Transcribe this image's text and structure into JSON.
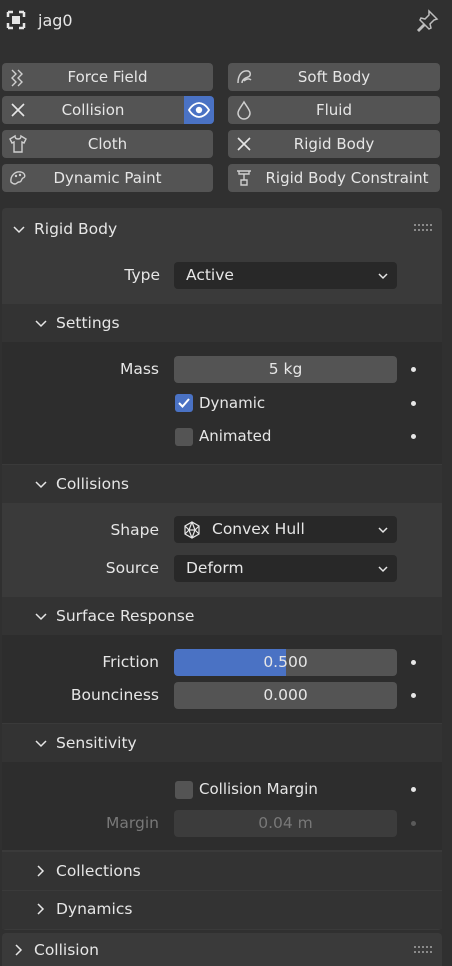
{
  "object": {
    "name": "jag0",
    "icon": "object-data-icon",
    "pin_icon": "pin-icon"
  },
  "physics_buttons": [
    {
      "label": "Force Field",
      "icon": "force-field-icon"
    },
    {
      "label": "Soft Body",
      "icon": "soft-body-icon"
    },
    {
      "label": "Collision",
      "icon": "remove-x-icon",
      "enabled": true
    },
    {
      "label": "Fluid",
      "icon": "fluid-drop-icon"
    },
    {
      "label": "Cloth",
      "icon": "cloth-shirt-icon"
    },
    {
      "label": "Rigid Body",
      "icon": "remove-x-icon",
      "enabled": true
    },
    {
      "label": "Dynamic Paint",
      "icon": "dynamic-paint-icon"
    },
    {
      "label": "Rigid Body Constraint",
      "icon": "constraint-icon"
    }
  ],
  "rigid_body": {
    "title": "Rigid Body",
    "type_label": "Type",
    "type_value": "Active",
    "settings": {
      "title": "Settings",
      "mass_label": "Mass",
      "mass_value": "5 kg",
      "dynamic_label": "Dynamic",
      "dynamic_checked": true,
      "animated_label": "Animated",
      "animated_checked": false
    },
    "collisions": {
      "title": "Collisions",
      "shape_label": "Shape",
      "shape_value": "Convex Hull",
      "source_label": "Source",
      "source_value": "Deform",
      "surface_response": {
        "title": "Surface Response",
        "friction_label": "Friction",
        "friction_value": "0.500",
        "friction_fraction": 0.5,
        "bounciness_label": "Bounciness",
        "bounciness_value": "0.000"
      },
      "sensitivity": {
        "title": "Sensitivity",
        "collision_margin_label": "Collision Margin",
        "collision_margin_checked": false,
        "margin_label": "Margin",
        "margin_value": "0.04 m"
      }
    },
    "collections_title": "Collections",
    "dynamics_title": "Dynamics"
  },
  "collision_panel": {
    "title": "Collision"
  },
  "colors": {
    "accent": "#4a72c4",
    "button": "#545454",
    "background": "#303030"
  }
}
